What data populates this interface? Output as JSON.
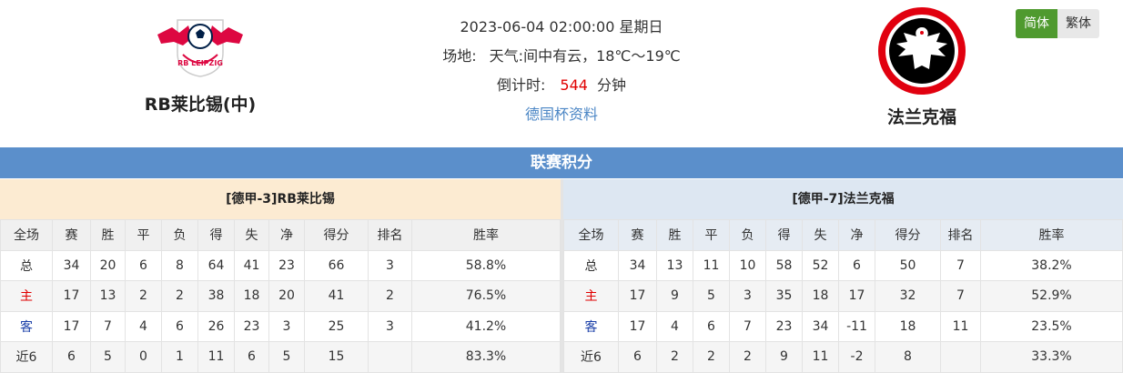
{
  "match": {
    "datetime": "2023-06-04 02:00:00 星期日",
    "venue_label": "场地:",
    "weather_label": "天气:",
    "weather": "间中有云，18℃～19℃",
    "countdown_label": "倒计时:",
    "countdown_value": "544",
    "countdown_unit": "分钟",
    "cup_link": "德国杯资料"
  },
  "home_team": {
    "name": "RB莱比锡(中)",
    "logo_text": "RB LEIPZIG",
    "colors": {
      "primary": "#dd0741",
      "secondary": "#001f47",
      "ball": "#ffffff"
    }
  },
  "away_team": {
    "name": "法兰克福",
    "colors": {
      "primary": "#e1000f",
      "secondary": "#000000"
    }
  },
  "lang": {
    "simplified": "简体",
    "traditional": "繁体"
  },
  "section_title": "联赛积分",
  "columns": [
    "全场",
    "赛",
    "胜",
    "平",
    "负",
    "得",
    "失",
    "净",
    "得分",
    "排名",
    "胜率"
  ],
  "home_table": {
    "title": "[德甲-3]RB莱比锡",
    "rows": [
      [
        "总",
        "34",
        "20",
        "6",
        "8",
        "64",
        "41",
        "23",
        "66",
        "3",
        "58.8%"
      ],
      [
        "主",
        "17",
        "13",
        "2",
        "2",
        "38",
        "18",
        "20",
        "41",
        "2",
        "76.5%"
      ],
      [
        "客",
        "17",
        "7",
        "4",
        "6",
        "26",
        "23",
        "3",
        "25",
        "3",
        "41.2%"
      ],
      [
        "近6",
        "6",
        "5",
        "0",
        "1",
        "11",
        "6",
        "5",
        "15",
        "",
        "83.3%"
      ]
    ]
  },
  "away_table": {
    "title": "[德甲-7]法兰克福",
    "rows": [
      [
        "总",
        "34",
        "13",
        "11",
        "10",
        "58",
        "52",
        "6",
        "50",
        "7",
        "38.2%"
      ],
      [
        "主",
        "17",
        "9",
        "5",
        "3",
        "35",
        "18",
        "17",
        "32",
        "7",
        "52.9%"
      ],
      [
        "客",
        "17",
        "4",
        "6",
        "7",
        "23",
        "34",
        "-11",
        "18",
        "11",
        "23.5%"
      ],
      [
        "近6",
        "6",
        "2",
        "2",
        "2",
        "9",
        "11",
        "-2",
        "8",
        "",
        "33.3%"
      ]
    ]
  },
  "colors": {
    "section_bar": "#5b8fcb",
    "home_panel": "#fcebd2",
    "away_panel": "#dde7f2",
    "countdown": "#e00000",
    "link": "#4b86c5",
    "lang_active": "#4f9a2f"
  }
}
